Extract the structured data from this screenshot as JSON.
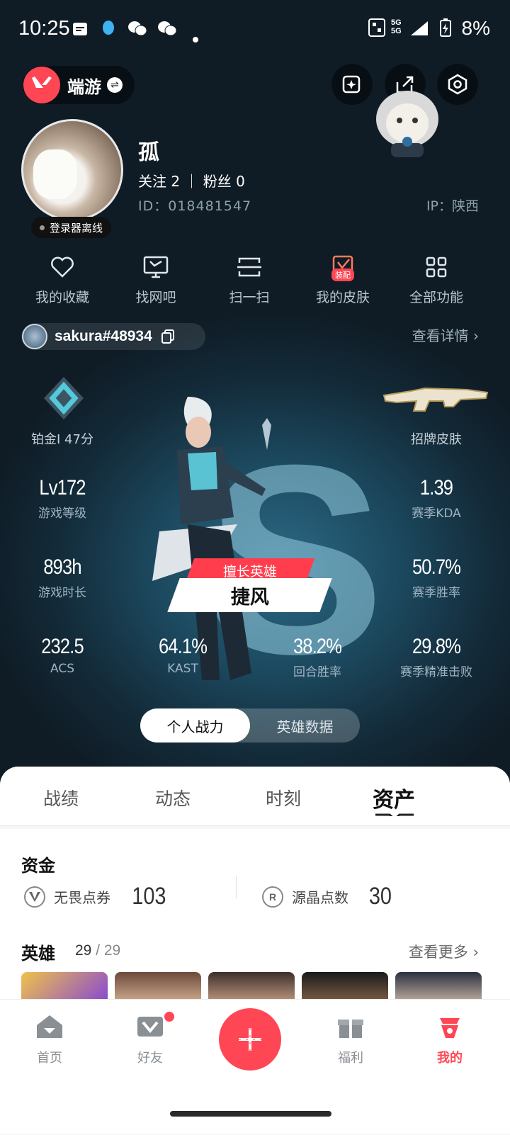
{
  "status_bar": {
    "time": "10:25",
    "network": "5G",
    "battery": "8%"
  },
  "top_bar": {
    "app_switch_label": "端游",
    "icons": [
      "spark-icon",
      "share-icon",
      "settings-hex-icon"
    ]
  },
  "profile": {
    "name": "孤",
    "follow_text": "关注 2 ｜ 粉丝 0",
    "id_text": "ID：018481547",
    "ip_text": "IP：陕西",
    "status_text": "登录器离线"
  },
  "menu": [
    {
      "label": "我的收藏",
      "icon": "heart-icon"
    },
    {
      "label": "找网吧",
      "icon": "monitor-icon"
    },
    {
      "label": "扫一扫",
      "icon": "scan-icon"
    },
    {
      "label": "我的皮肤",
      "icon": "skin-icon",
      "badge": "装配"
    },
    {
      "label": "全部功能",
      "icon": "grid-icon"
    }
  ],
  "account": {
    "riot_id": "sakura#48934",
    "detail_link": "查看详情 ›"
  },
  "rank": {
    "label": "铂金I 47分"
  },
  "skin": {
    "label": "招牌皮肤"
  },
  "stats": {
    "level": {
      "value": "Lv172",
      "label": "游戏等级"
    },
    "kda": {
      "value": "1.39",
      "label": "赛季KDA"
    },
    "hours": {
      "value": "893h",
      "label": "游戏时长"
    },
    "winrate": {
      "value": "50.7%",
      "label": "赛季胜率"
    },
    "acs": {
      "value": "232.5",
      "label": "ACS"
    },
    "kast": {
      "value": "64.1%",
      "label": "KAST"
    },
    "round_win": {
      "value": "38.2%",
      "label": "回合胜率"
    },
    "hs": {
      "value": "29.8%",
      "label": "赛季精准击败"
    }
  },
  "best_hero": {
    "tag": "擅长英雄",
    "name": "捷风"
  },
  "toggle": {
    "active": "个人战力",
    "inactive": "英雄数据"
  },
  "tabs": [
    "战绩",
    "动态",
    "时刻",
    "资产"
  ],
  "active_tab": "资产",
  "funds": {
    "title": "资金",
    "items": [
      {
        "label": "无畏点券",
        "value": "103",
        "icon": "vp-icon"
      },
      {
        "label": "源晶点数",
        "value": "30",
        "icon": "radianite-icon",
        "glyph": "R"
      }
    ]
  },
  "heroes_section": {
    "title": "英雄",
    "count": "29",
    "total": "29",
    "more": "查看更多 ›"
  },
  "bottom_nav": [
    {
      "label": "首页",
      "icon": "home-icon"
    },
    {
      "label": "好友",
      "icon": "friends-icon"
    },
    {
      "label": "福利",
      "icon": "gift-icon"
    },
    {
      "label": "我的",
      "icon": "mine-icon"
    }
  ],
  "colors": {
    "accent": "#ff4655",
    "sheet": "#ffffff",
    "dark_bg": "#0f1c26"
  }
}
